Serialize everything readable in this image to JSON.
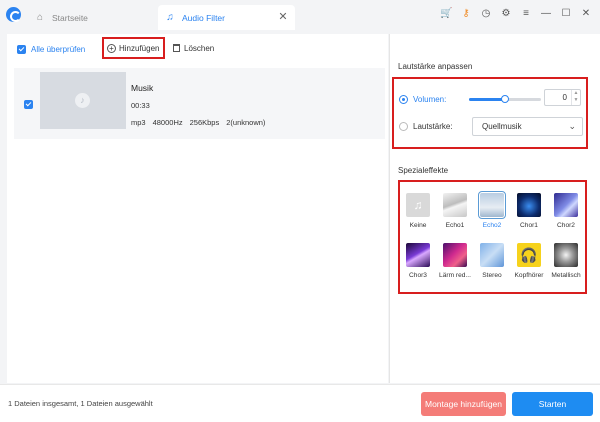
{
  "tabs": {
    "home_label": "Startseite",
    "home_icon": "home-icon",
    "filter_label": "Audio Filter",
    "filter_icon": "music-note-icon",
    "close_glyph": "✕"
  },
  "window_icons": [
    "cart-icon",
    "key-icon",
    "clock-icon",
    "gear-icon",
    "menu-icon",
    "minimize-icon",
    "maximize-icon",
    "close-icon"
  ],
  "window_glyphs": {
    "cart": "🛒",
    "key": "🔑",
    "clock": "◷",
    "gear": "⚙",
    "menu": "≡",
    "minimize": "—",
    "maximize": "☐",
    "close": "✕"
  },
  "toolbar": {
    "select_all_label": "Alle überprüfen",
    "add_label": "Hinzufügen",
    "delete_label": "Löschen"
  },
  "file": {
    "checked": true,
    "name": "Musik",
    "duration": "00:33",
    "format": "mp3",
    "sample_rate": "48000Hz",
    "bitrate": "256Kbps",
    "channels": "2(unknown)",
    "thumb_icon": "♪"
  },
  "volume": {
    "section_title": "Lautstärke anpassen",
    "volumen_label": "Volumen:",
    "volumen_selected": true,
    "slider_fraction": 0.5,
    "value": "0",
    "loudness_label": "Lautstärke:",
    "loudness_selected": false,
    "loudness_value": "Quellmusik"
  },
  "effects": {
    "section_title": "Spezialeffekte",
    "items": [
      {
        "label": "Keine",
        "selected": false
      },
      {
        "label": "Echo1",
        "selected": false
      },
      {
        "label": "Echo2",
        "selected": true
      },
      {
        "label": "Chor1",
        "selected": false
      },
      {
        "label": "Chor2",
        "selected": false
      },
      {
        "label": "Chor3",
        "selected": false
      },
      {
        "label": "Lärm red...",
        "selected": false
      },
      {
        "label": "Stereo",
        "selected": false
      },
      {
        "label": "Kopfhörer",
        "selected": false
      },
      {
        "label": "Metallisch",
        "selected": false
      }
    ]
  },
  "footer": {
    "summary": "1 Dateien insgesamt, 1 Dateien ausgewählt",
    "montage_label": "Montage hinzufügen",
    "start_label": "Starten"
  },
  "colors": {
    "accent": "#2b83f0",
    "highlight_border": "#d81e1e",
    "montage": "#f47c78",
    "start": "#1e8cf2"
  }
}
